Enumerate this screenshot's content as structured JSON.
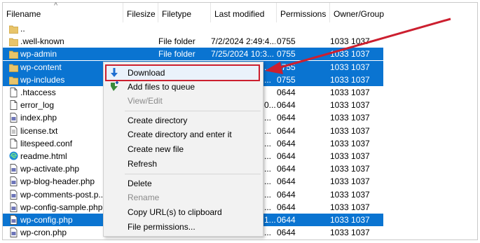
{
  "columns": {
    "filename": "Filename",
    "filesize": "Filesize",
    "filetype": "Filetype",
    "last_modified": "Last modified",
    "permissions": "Permissions",
    "owner_group": "Owner/Group"
  },
  "rows": [
    {
      "name": "..",
      "type": "",
      "modified": "",
      "perm": "",
      "owner": "",
      "icon": "folder-icon",
      "selected": false
    },
    {
      "name": ".well-known",
      "type": "File folder",
      "modified": "7/2/2024 2:49:4...",
      "perm": "0755",
      "owner": "1033 1037",
      "icon": "folder-icon",
      "selected": false
    },
    {
      "name": "wp-admin",
      "type": "File folder",
      "modified": "7/25/2024 10:3...",
      "perm": "0755",
      "owner": "1033 1037",
      "icon": "folder-icon",
      "selected": true
    },
    {
      "name": "wp-content",
      "type": "",
      "modified": "",
      "perm": "0755",
      "owner": "1033 1037",
      "icon": "folder-icon",
      "selected": true
    },
    {
      "name": "wp-includes",
      "type": "",
      "modified": "",
      "perm": "0755",
      "owner": "1033 1037",
      "icon": "folder-icon",
      "selected": true
    },
    {
      "name": ".htaccess",
      "type": "",
      "modified": "",
      "perm": "0644",
      "owner": "1033 1037",
      "icon": "file-icon",
      "selected": false
    },
    {
      "name": "error_log",
      "type": "",
      "modified": "",
      "perm": "0644",
      "owner": "1033 1037",
      "icon": "file-icon",
      "selected": false
    },
    {
      "name": "index.php",
      "type": "",
      "modified": "",
      "perm": "0644",
      "owner": "1033 1037",
      "icon": "php-file-icon",
      "selected": false
    },
    {
      "name": "license.txt",
      "type": "",
      "modified": "",
      "perm": "0644",
      "owner": "1033 1037",
      "icon": "text-file-icon",
      "selected": false
    },
    {
      "name": "litespeed.conf",
      "type": "",
      "modified": "",
      "perm": "0644",
      "owner": "1033 1037",
      "icon": "file-icon",
      "selected": false
    },
    {
      "name": "readme.html",
      "type": "",
      "modified": "",
      "perm": "0644",
      "owner": "1033 1037",
      "icon": "edge-html-icon",
      "selected": false
    },
    {
      "name": "wp-activate.php",
      "type": "",
      "modified": "",
      "perm": "0644",
      "owner": "1033 1037",
      "icon": "php-file-icon",
      "selected": false
    },
    {
      "name": "wp-blog-header.php",
      "type": "",
      "modified": "",
      "perm": "0644",
      "owner": "1033 1037",
      "icon": "php-file-icon",
      "selected": false
    },
    {
      "name": "wp-comments-post.p...",
      "type": "",
      "modified": "",
      "perm": "0644",
      "owner": "1033 1037",
      "icon": "php-file-icon",
      "selected": false
    },
    {
      "name": "wp-config-sample.php",
      "type": "",
      "modified": "",
      "perm": "0644",
      "owner": "1033 1037",
      "icon": "php-file-icon",
      "selected": false
    },
    {
      "name": "wp-config.php",
      "type": "",
      "modified": "",
      "perm": "0644",
      "owner": "1033 1037",
      "icon": "php-file-icon",
      "selected": true
    },
    {
      "name": "wp-cron.php",
      "type": "",
      "modified": "",
      "perm": "0644",
      "owner": "1033 1037",
      "icon": "php-file-icon",
      "selected": false
    }
  ],
  "modified_fragments": [
    "",
    "",
    "",
    "...",
    "...",
    "",
    "0...",
    "...",
    "...",
    "...",
    "...",
    "...",
    "...",
    "...",
    "...",
    "1...",
    "..."
  ],
  "context_menu": {
    "download": "Download",
    "add_to_queue": "Add files to queue",
    "view_edit": "View/Edit",
    "create_directory": "Create directory",
    "create_directory_enter": "Create directory and enter it",
    "create_new_file": "Create new file",
    "refresh": "Refresh",
    "delete": "Delete",
    "rename": "Rename",
    "copy_url": "Copy URL(s) to clipboard",
    "file_permissions": "File permissions..."
  },
  "colors": {
    "selection": "#0a74d1",
    "annotation": "#cc1f2f",
    "folder": "#e8c46a"
  }
}
